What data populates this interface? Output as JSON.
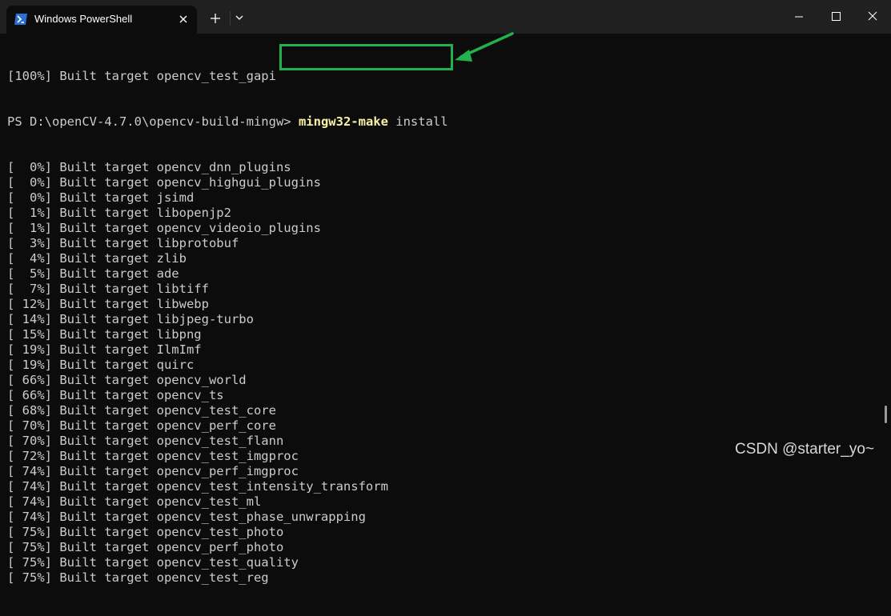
{
  "window": {
    "tab_title": "Windows PowerShell",
    "tab_icon": "powershell-icon",
    "buttons": [
      "minimize-icon",
      "maximize-icon",
      "close-icon"
    ]
  },
  "terminal": {
    "first_line": "[100%] Built target opencv_test_gapi",
    "prompt": "PS D:\\openCV-4.7.0\\opencv-build-mingw> ",
    "command_name": "mingw32-make",
    "command_args": " install",
    "output_lines": [
      "[  0%] Built target opencv_dnn_plugins",
      "[  0%] Built target opencv_highgui_plugins",
      "[  0%] Built target jsimd",
      "[  1%] Built target libopenjp2",
      "[  1%] Built target opencv_videoio_plugins",
      "[  3%] Built target libprotobuf",
      "[  4%] Built target zlib",
      "[  5%] Built target ade",
      "[  7%] Built target libtiff",
      "[ 12%] Built target libwebp",
      "[ 14%] Built target libjpeg-turbo",
      "[ 15%] Built target libpng",
      "[ 19%] Built target IlmImf",
      "[ 19%] Built target quirc",
      "[ 66%] Built target opencv_world",
      "[ 66%] Built target opencv_ts",
      "[ 68%] Built target opencv_test_core",
      "[ 70%] Built target opencv_perf_core",
      "[ 70%] Built target opencv_test_flann",
      "[ 72%] Built target opencv_test_imgproc",
      "[ 74%] Built target opencv_perf_imgproc",
      "[ 74%] Built target opencv_test_intensity_transform",
      "[ 74%] Built target opencv_test_ml",
      "[ 74%] Built target opencv_test_phase_unwrapping",
      "[ 75%] Built target opencv_test_photo",
      "[ 75%] Built target opencv_perf_photo",
      "[ 75%] Built target opencv_test_quality",
      "[ 75%] Built target opencv_test_reg"
    ]
  },
  "annotation_color": "#22b14c",
  "watermark": "CSDN @starter_yo~"
}
